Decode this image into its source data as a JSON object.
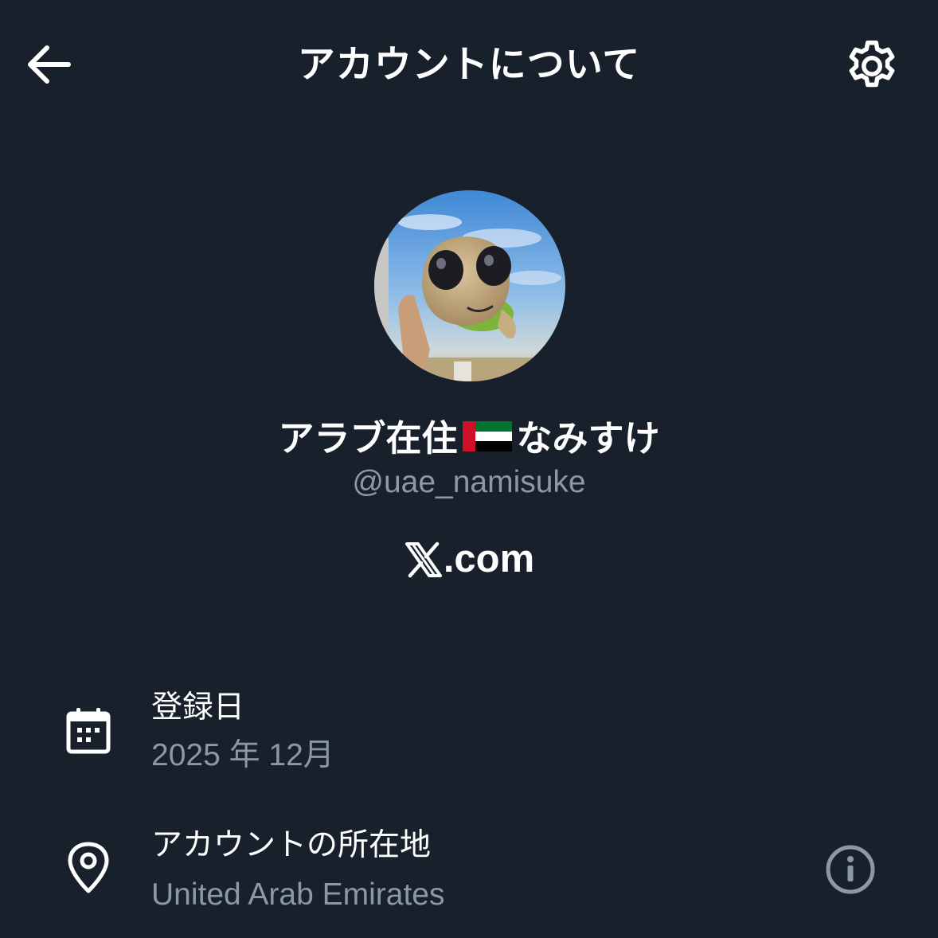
{
  "header": {
    "back_icon": "arrow-left-icon",
    "title": "アカウントについて",
    "settings_icon": "gear-icon"
  },
  "profile": {
    "avatar": "avatar-photo-plush-turtle",
    "display_name_before_flag": "アラブ在住",
    "flag_icon": "uae-flag-icon",
    "display_name_after_flag": "なみすけ",
    "handle": "@uae_namisuke",
    "platform_logo": "x-logo-icon",
    "platform_text": ".com"
  },
  "details": [
    {
      "icon": "calendar-icon",
      "label": "登録日",
      "value": "2025 年 12月"
    },
    {
      "icon": "location-pin-icon",
      "label": "アカウントの所在地",
      "value": "United Arab Emirates",
      "info_icon": "info-icon"
    }
  ],
  "colors": {
    "background": "#17202b",
    "primary_text": "#ffffff",
    "secondary_text": "#8b98a5",
    "icon_muted": "#8b98a5",
    "flag_red": "#ce1126",
    "flag_green": "#00732f",
    "flag_white": "#ffffff",
    "flag_black": "#000000"
  }
}
